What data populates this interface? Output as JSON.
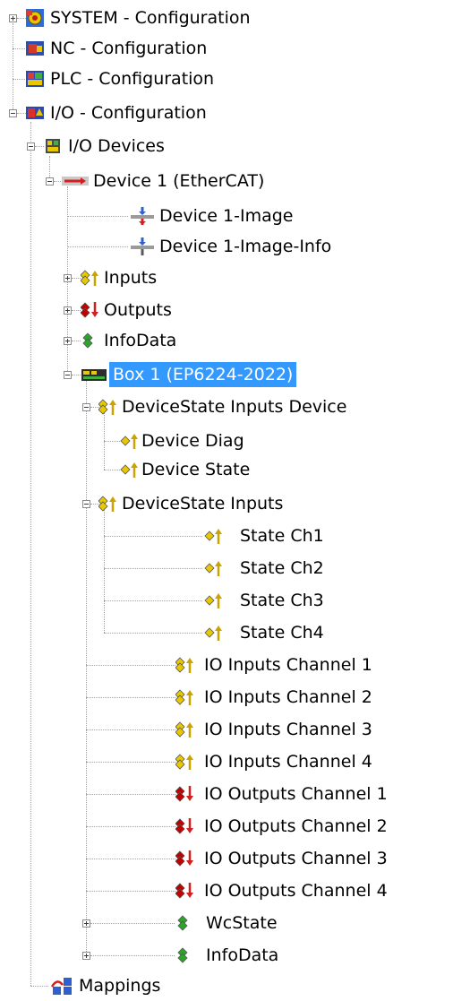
{
  "tree": {
    "items": [
      {
        "label": "SYSTEM - Configuration",
        "icon": "system-config-icon"
      },
      {
        "label": "NC - Configuration",
        "icon": "nc-config-icon"
      },
      {
        "label": "PLC - Configuration",
        "icon": "plc-config-icon"
      },
      {
        "label": "I/O - Configuration",
        "icon": "io-config-icon"
      },
      {
        "label": "I/O Devices",
        "icon": "io-devices-icon"
      },
      {
        "label": "Device 1 (EtherCAT)",
        "icon": "ethercat-device-icon"
      },
      {
        "label": "Device 1-Image",
        "icon": "image-icon"
      },
      {
        "label": "Device 1-Image-Info",
        "icon": "image-icon"
      },
      {
        "label": "Inputs",
        "icon": "inputs-icon"
      },
      {
        "label": "Outputs",
        "icon": "outputs-icon"
      },
      {
        "label": "InfoData",
        "icon": "infodata-icon"
      },
      {
        "label": "Box 1 (EP6224-2022)",
        "icon": "box-icon",
        "selected": true
      },
      {
        "label": "DeviceState Inputs Device",
        "icon": "inputs-icon"
      },
      {
        "label": "Device Diag",
        "icon": "input-var-icon"
      },
      {
        "label": "Device State",
        "icon": "input-var-icon"
      },
      {
        "label": "DeviceState Inputs",
        "icon": "inputs-icon"
      },
      {
        "label": "State Ch1",
        "icon": "input-var-icon"
      },
      {
        "label": "State Ch2",
        "icon": "input-var-icon"
      },
      {
        "label": "State Ch3",
        "icon": "input-var-icon"
      },
      {
        "label": "State Ch4",
        "icon": "input-var-icon"
      },
      {
        "label": "IO Inputs Channel 1",
        "icon": "inputs-icon"
      },
      {
        "label": "IO Inputs Channel 2",
        "icon": "inputs-icon"
      },
      {
        "label": "IO Inputs Channel 3",
        "icon": "inputs-icon"
      },
      {
        "label": "IO Inputs Channel 4",
        "icon": "inputs-icon"
      },
      {
        "label": "IO Outputs Channel 1",
        "icon": "outputs-icon"
      },
      {
        "label": "IO Outputs Channel 2",
        "icon": "outputs-icon"
      },
      {
        "label": "IO Outputs Channel 3",
        "icon": "outputs-icon"
      },
      {
        "label": "IO Outputs Channel 4",
        "icon": "outputs-icon"
      },
      {
        "label": "WcState",
        "icon": "infodata-icon"
      },
      {
        "label": "InfoData",
        "icon": "infodata-icon"
      },
      {
        "label": "Mappings",
        "icon": "mappings-icon"
      }
    ]
  },
  "colors": {
    "selection": "#3399ff",
    "tree_lines": "#a0a0a0",
    "input_yellow": "#e8c800",
    "output_red": "#c00000",
    "info_green": "#2aa52a"
  }
}
